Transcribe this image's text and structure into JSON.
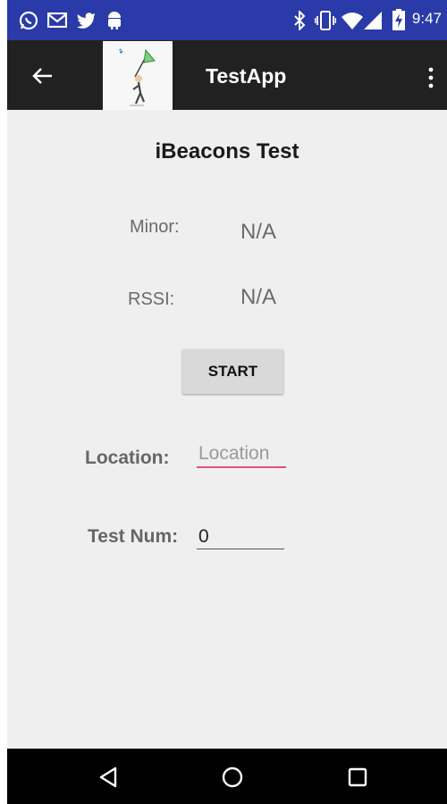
{
  "status_bar": {
    "time": "9:47",
    "left_icons": [
      "whatsapp-icon",
      "gmail-icon",
      "twitter-icon",
      "android-icon"
    ],
    "right_icons": [
      "bluetooth-icon",
      "vibrate-icon",
      "wifi-icon",
      "signal-icon",
      "battery-charging-icon"
    ],
    "color": "#2a3aa8"
  },
  "app_bar": {
    "title": "TestApp",
    "back_icon": "back-arrow-icon",
    "menu_icon": "overflow-menu-icon",
    "color": "#212121"
  },
  "main": {
    "title": "iBeacons Test",
    "minor_label": "Minor:",
    "minor_value": "N/A",
    "rssi_label": "RSSI:",
    "rssi_value": "N/A",
    "start_button": "START",
    "location_label": "Location:",
    "location_placeholder": "Location",
    "test_num_label": "Test Num:",
    "test_num_value": "0",
    "accent_color": "#e0508a"
  },
  "nav_bar": {
    "icons": [
      "back-triangle-icon",
      "home-circle-icon",
      "recents-square-icon"
    ]
  }
}
